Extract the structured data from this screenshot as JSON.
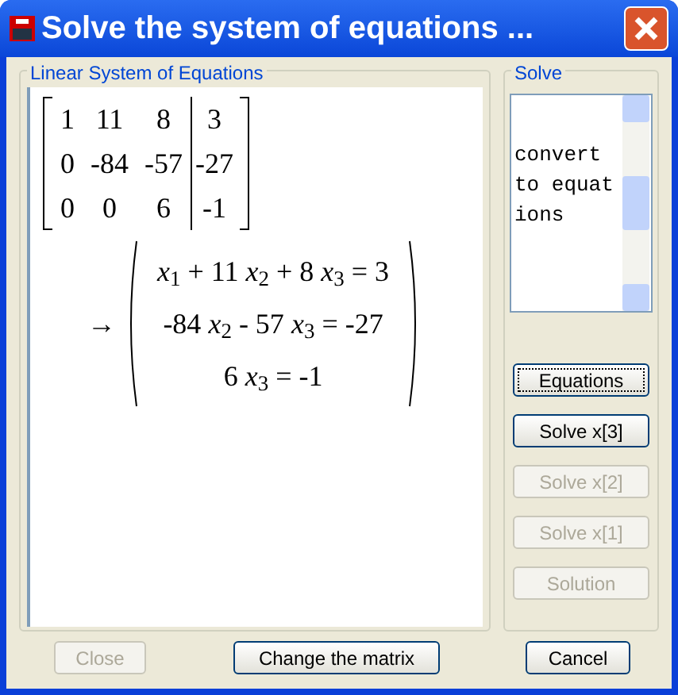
{
  "window": {
    "title": "Solve the system of equations ..."
  },
  "system_group": {
    "title": "Linear System of Equations",
    "matrix": [
      {
        "coefficients": [
          "1",
          "11",
          "8"
        ],
        "constant": "3"
      },
      {
        "coefficients": [
          "0",
          "-84",
          "-57"
        ],
        "constant": "-27"
      },
      {
        "coefficients": [
          "0",
          "0",
          "6"
        ],
        "constant": "-1"
      }
    ],
    "arrow": "→",
    "equations": [
      "*x*$_{1}$ + 11 *x*$_{2}$ + 8 *x*$_{3}$ = 3",
      "-84 *x*$_{2}$ - 57 *x*$_{3}$ = -27",
      "6 *x*$_{3}$ = -1"
    ]
  },
  "solve_group": {
    "title": "Solve",
    "log_text": "convert to equations",
    "buttons": [
      {
        "label": "Equations",
        "disabled": false,
        "focused": true
      },
      {
        "label": "Solve x[3]",
        "disabled": false,
        "focused": false
      },
      {
        "label": "Solve x[2]",
        "disabled": true,
        "focused": false
      },
      {
        "label": "Solve x[1]",
        "disabled": true,
        "focused": false
      },
      {
        "label": "Solution",
        "disabled": true,
        "focused": false
      }
    ]
  },
  "bottom_buttons": [
    {
      "label": "Close",
      "disabled": true
    },
    {
      "label": "Change the matrix",
      "disabled": false
    },
    {
      "label": "Cancel",
      "disabled": false
    }
  ]
}
